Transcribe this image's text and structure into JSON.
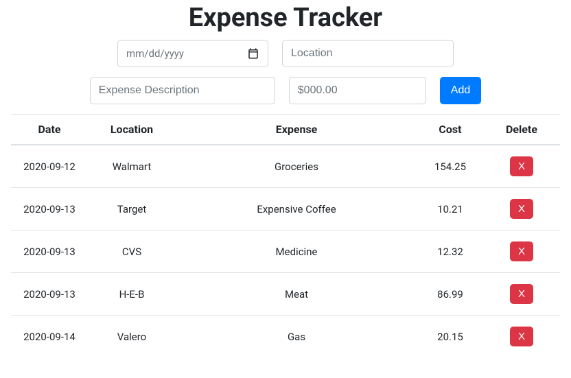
{
  "title": "Expense Tracker",
  "form": {
    "date_placeholder": "mm/dd/yyyy",
    "location_placeholder": "Location",
    "description_placeholder": "Expense Description",
    "cost_placeholder": "$000.00",
    "add_label": "Add"
  },
  "table": {
    "headers": {
      "date": "Date",
      "location": "Location",
      "expense": "Expense",
      "cost": "Cost",
      "delete": "Delete"
    },
    "rows": [
      {
        "date": "2020-09-12",
        "location": "Walmart",
        "expense": "Groceries",
        "cost": "154.25"
      },
      {
        "date": "2020-09-13",
        "location": "Target",
        "expense": "Expensive Coffee",
        "cost": "10.21"
      },
      {
        "date": "2020-09-13",
        "location": "CVS",
        "expense": "Medicine",
        "cost": "12.32"
      },
      {
        "date": "2020-09-13",
        "location": "H-E-B",
        "expense": "Meat",
        "cost": "86.99"
      },
      {
        "date": "2020-09-14",
        "location": "Valero",
        "expense": "Gas",
        "cost": "20.15"
      }
    ],
    "delete_label": "X"
  }
}
